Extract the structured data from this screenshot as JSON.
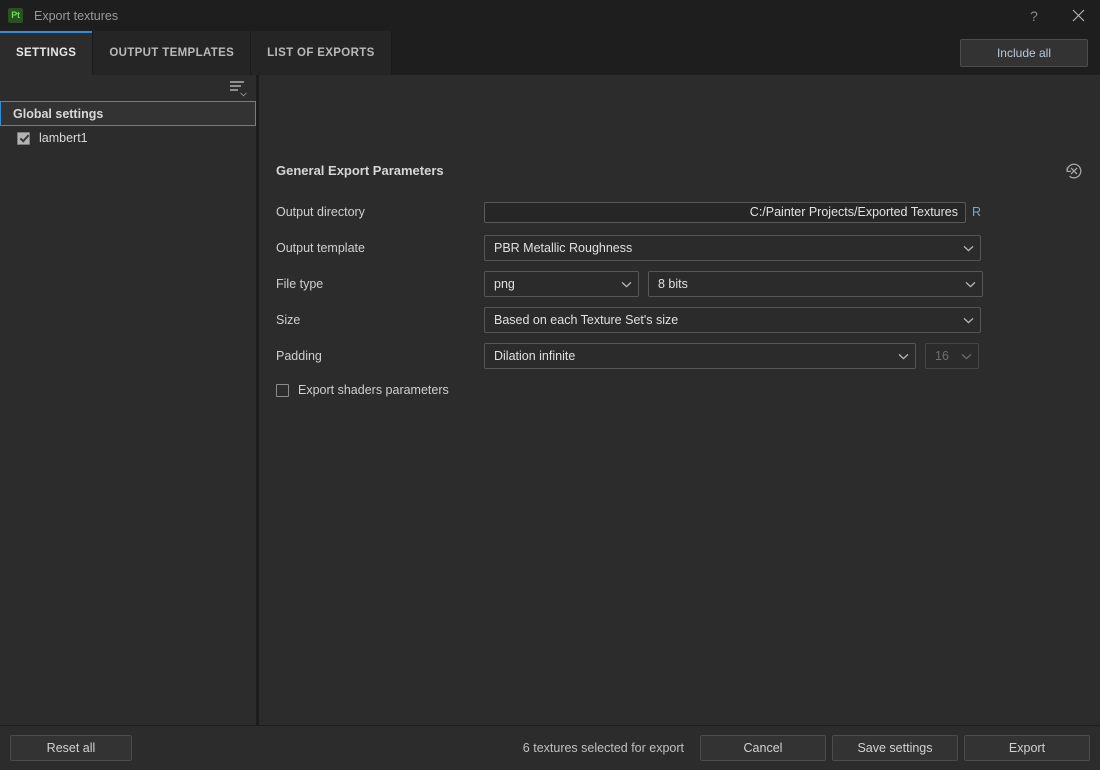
{
  "window": {
    "app_badge": "Pt",
    "title": "Export textures",
    "help_icon": "?",
    "close_icon": "close-icon"
  },
  "tabs": [
    {
      "label": "SETTINGS",
      "active": true
    },
    {
      "label": "OUTPUT TEMPLATES",
      "active": false
    },
    {
      "label": "LIST OF EXPORTS",
      "active": false
    }
  ],
  "toolbar": {
    "include_all_label": "Include all"
  },
  "sidebar": {
    "filter_icon": "filter-sort-icon",
    "items": [
      {
        "label": "Global settings",
        "type": "group",
        "selected": true
      },
      {
        "label": "lambert1",
        "type": "texture-set",
        "checked": true
      }
    ]
  },
  "main": {
    "panel_title": "General Export Parameters",
    "revert_icon": "revert-reset-icon",
    "fields": {
      "output_directory": {
        "label": "Output directory",
        "value": "C:/Painter Projects/Exported Textures",
        "browse_label": "R"
      },
      "output_template": {
        "label": "Output template",
        "value": "PBR Metallic Roughness"
      },
      "file_type": {
        "label": "File type",
        "value": "png",
        "bit_depth": "8 bits"
      },
      "size": {
        "label": "Size",
        "value": "Based on each Texture Set's size"
      },
      "padding": {
        "label": "Padding",
        "value": "Dilation infinite",
        "amount": "16"
      },
      "export_shaders": {
        "label": "Export shaders parameters",
        "checked": false
      }
    }
  },
  "footer": {
    "reset_label": "Reset all",
    "status": "6 textures selected for export",
    "cancel_label": "Cancel",
    "save_label": "Save settings",
    "export_label": "Export"
  },
  "colors": {
    "accent": "#2f8fd8",
    "link": "#6fa8dc",
    "background": "#2c2c2c",
    "titlebar": "#1e1e1e"
  }
}
